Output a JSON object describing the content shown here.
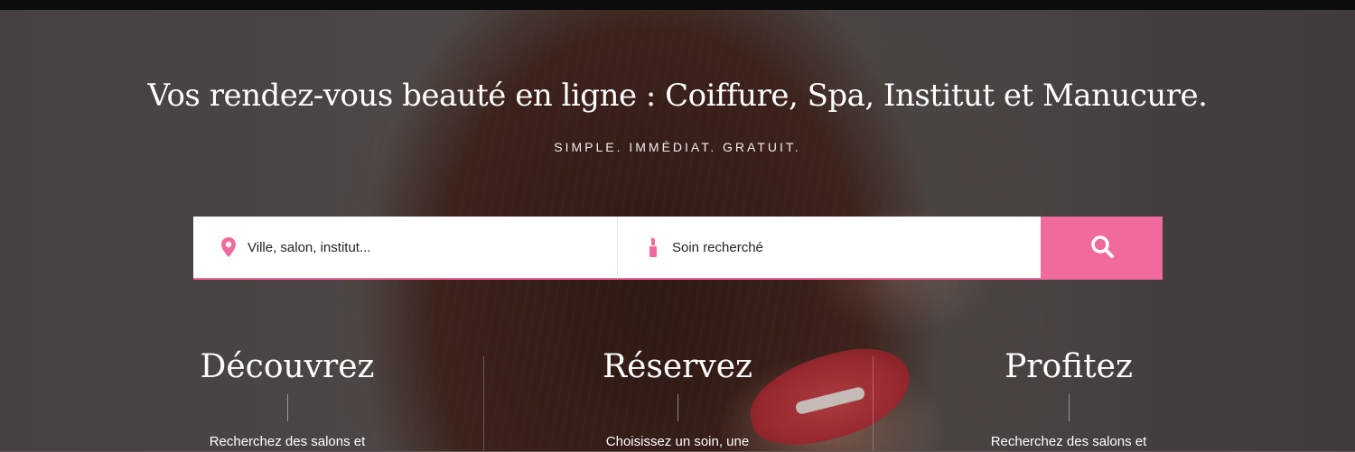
{
  "hero": {
    "headline": "Vos rendez-vous beauté en ligne : Coiffure, Spa, Institut et Manucure.",
    "tagline": "SIMPLE. IMMÉDIAT. GRATUIT."
  },
  "search": {
    "location_placeholder": "Ville, salon, institut...",
    "service_placeholder": "Soin recherché",
    "location_icon": "map-pin-icon",
    "service_icon": "lipstick-icon",
    "button_icon": "search-icon"
  },
  "features": [
    {
      "title": "Découvrez",
      "text": "Recherchez des salons et"
    },
    {
      "title": "Réservez",
      "text": "Choisissez un soin, une"
    },
    {
      "title": "Profitez",
      "text": "Recherchez des salons et"
    }
  ],
  "colors": {
    "accent": "#f06a9e",
    "top_bar": "#0d0c0c"
  }
}
